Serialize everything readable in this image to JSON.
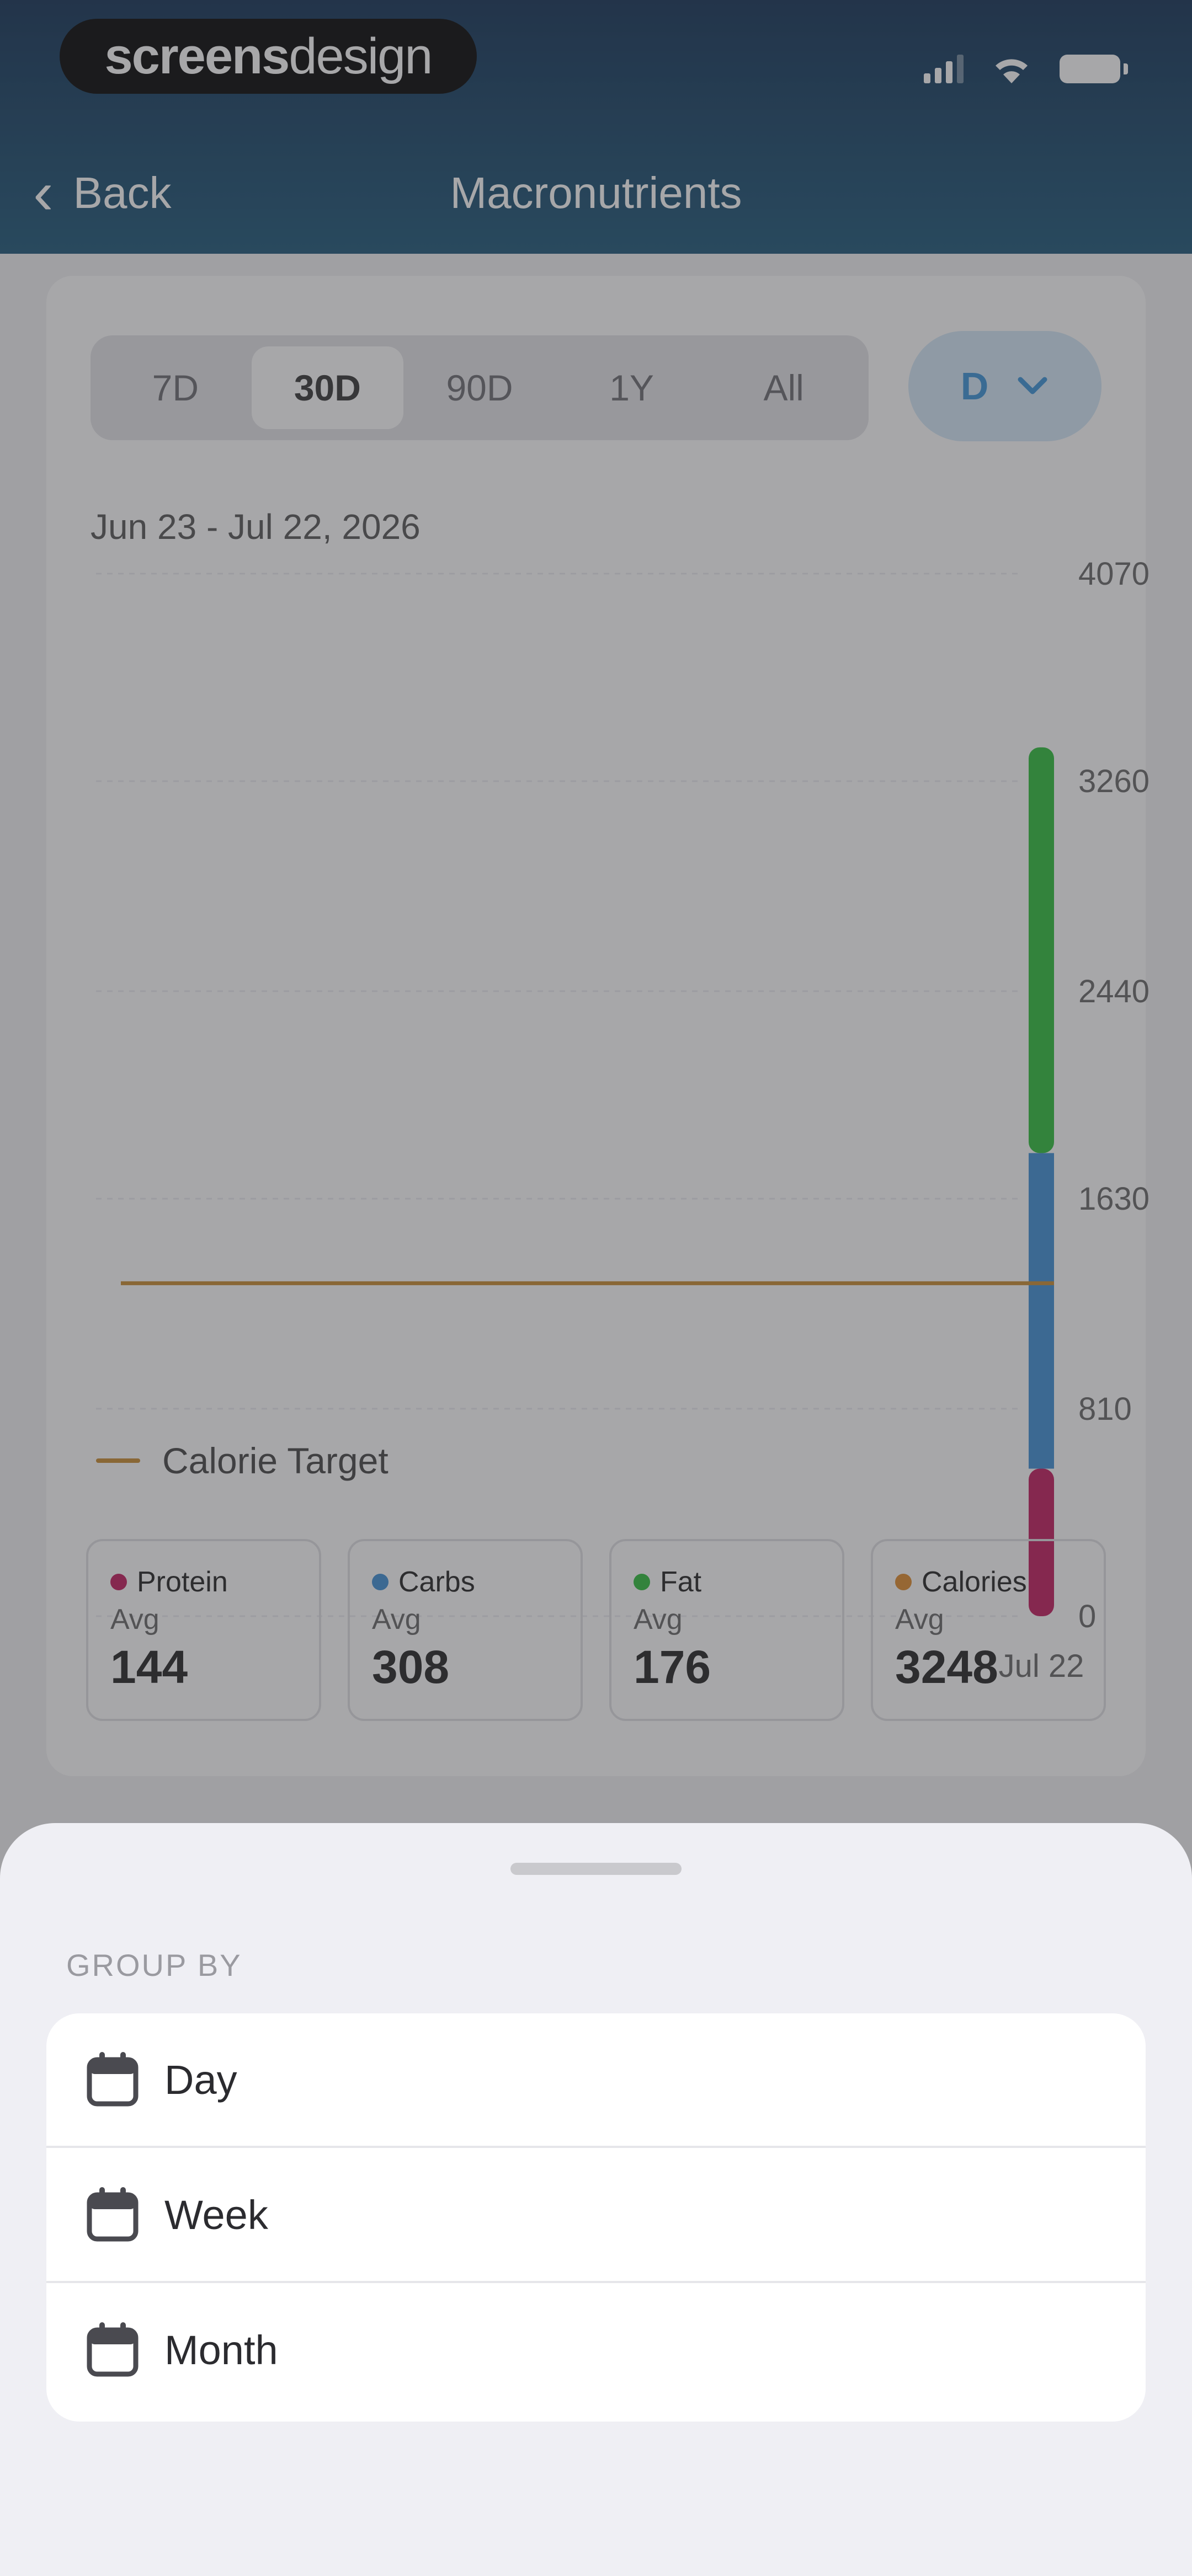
{
  "status_bar": {
    "brand_bold": "screens",
    "brand_light": "design"
  },
  "nav": {
    "back_label": "Back",
    "title": "Macronutrients"
  },
  "range_tabs": {
    "items": [
      "7D",
      "30D",
      "90D",
      "1Y",
      "All"
    ],
    "active_index": 1
  },
  "group_button": {
    "label": "D"
  },
  "date_range": "Jun 23 - Jul 22, 2026",
  "colors": {
    "protein": "#c2185b",
    "carbs": "#3d8fd6",
    "fat": "#2dbd3a",
    "calories": "#e08a2a",
    "calorie_target_line": "#c98a2f"
  },
  "chart_data": {
    "type": "bar",
    "stacked": true,
    "categories": [
      "Jul 22"
    ],
    "series": [
      {
        "name": "Protein",
        "values": [
          576
        ]
      },
      {
        "name": "Carbs",
        "values": [
          1232
        ]
      },
      {
        "name": "Fat",
        "values": [
          1584
        ]
      }
    ],
    "calorie_target": 1300,
    "y_ticks": [
      0,
      810,
      1630,
      2440,
      3260,
      4070
    ],
    "ylim": [
      0,
      4070
    ],
    "x_tick_labels": [
      "Jul 22"
    ],
    "legend": [
      "Calorie Target"
    ],
    "grid": true
  },
  "stats": [
    {
      "name": "Protein",
      "sub": "Avg",
      "value": "144",
      "color_key": "protein"
    },
    {
      "name": "Carbs",
      "sub": "Avg",
      "value": "308",
      "color_key": "carbs"
    },
    {
      "name": "Fat",
      "sub": "Avg",
      "value": "176",
      "color_key": "fat"
    },
    {
      "name": "Calories",
      "sub": "Avg",
      "value": "3248",
      "color_key": "calories"
    }
  ],
  "sheet": {
    "section_label": "GROUP BY",
    "options": [
      {
        "label": "Day",
        "icon": "calendar-icon"
      },
      {
        "label": "Week",
        "icon": "calendar-icon"
      },
      {
        "label": "Month",
        "icon": "calendar-icon"
      }
    ]
  }
}
